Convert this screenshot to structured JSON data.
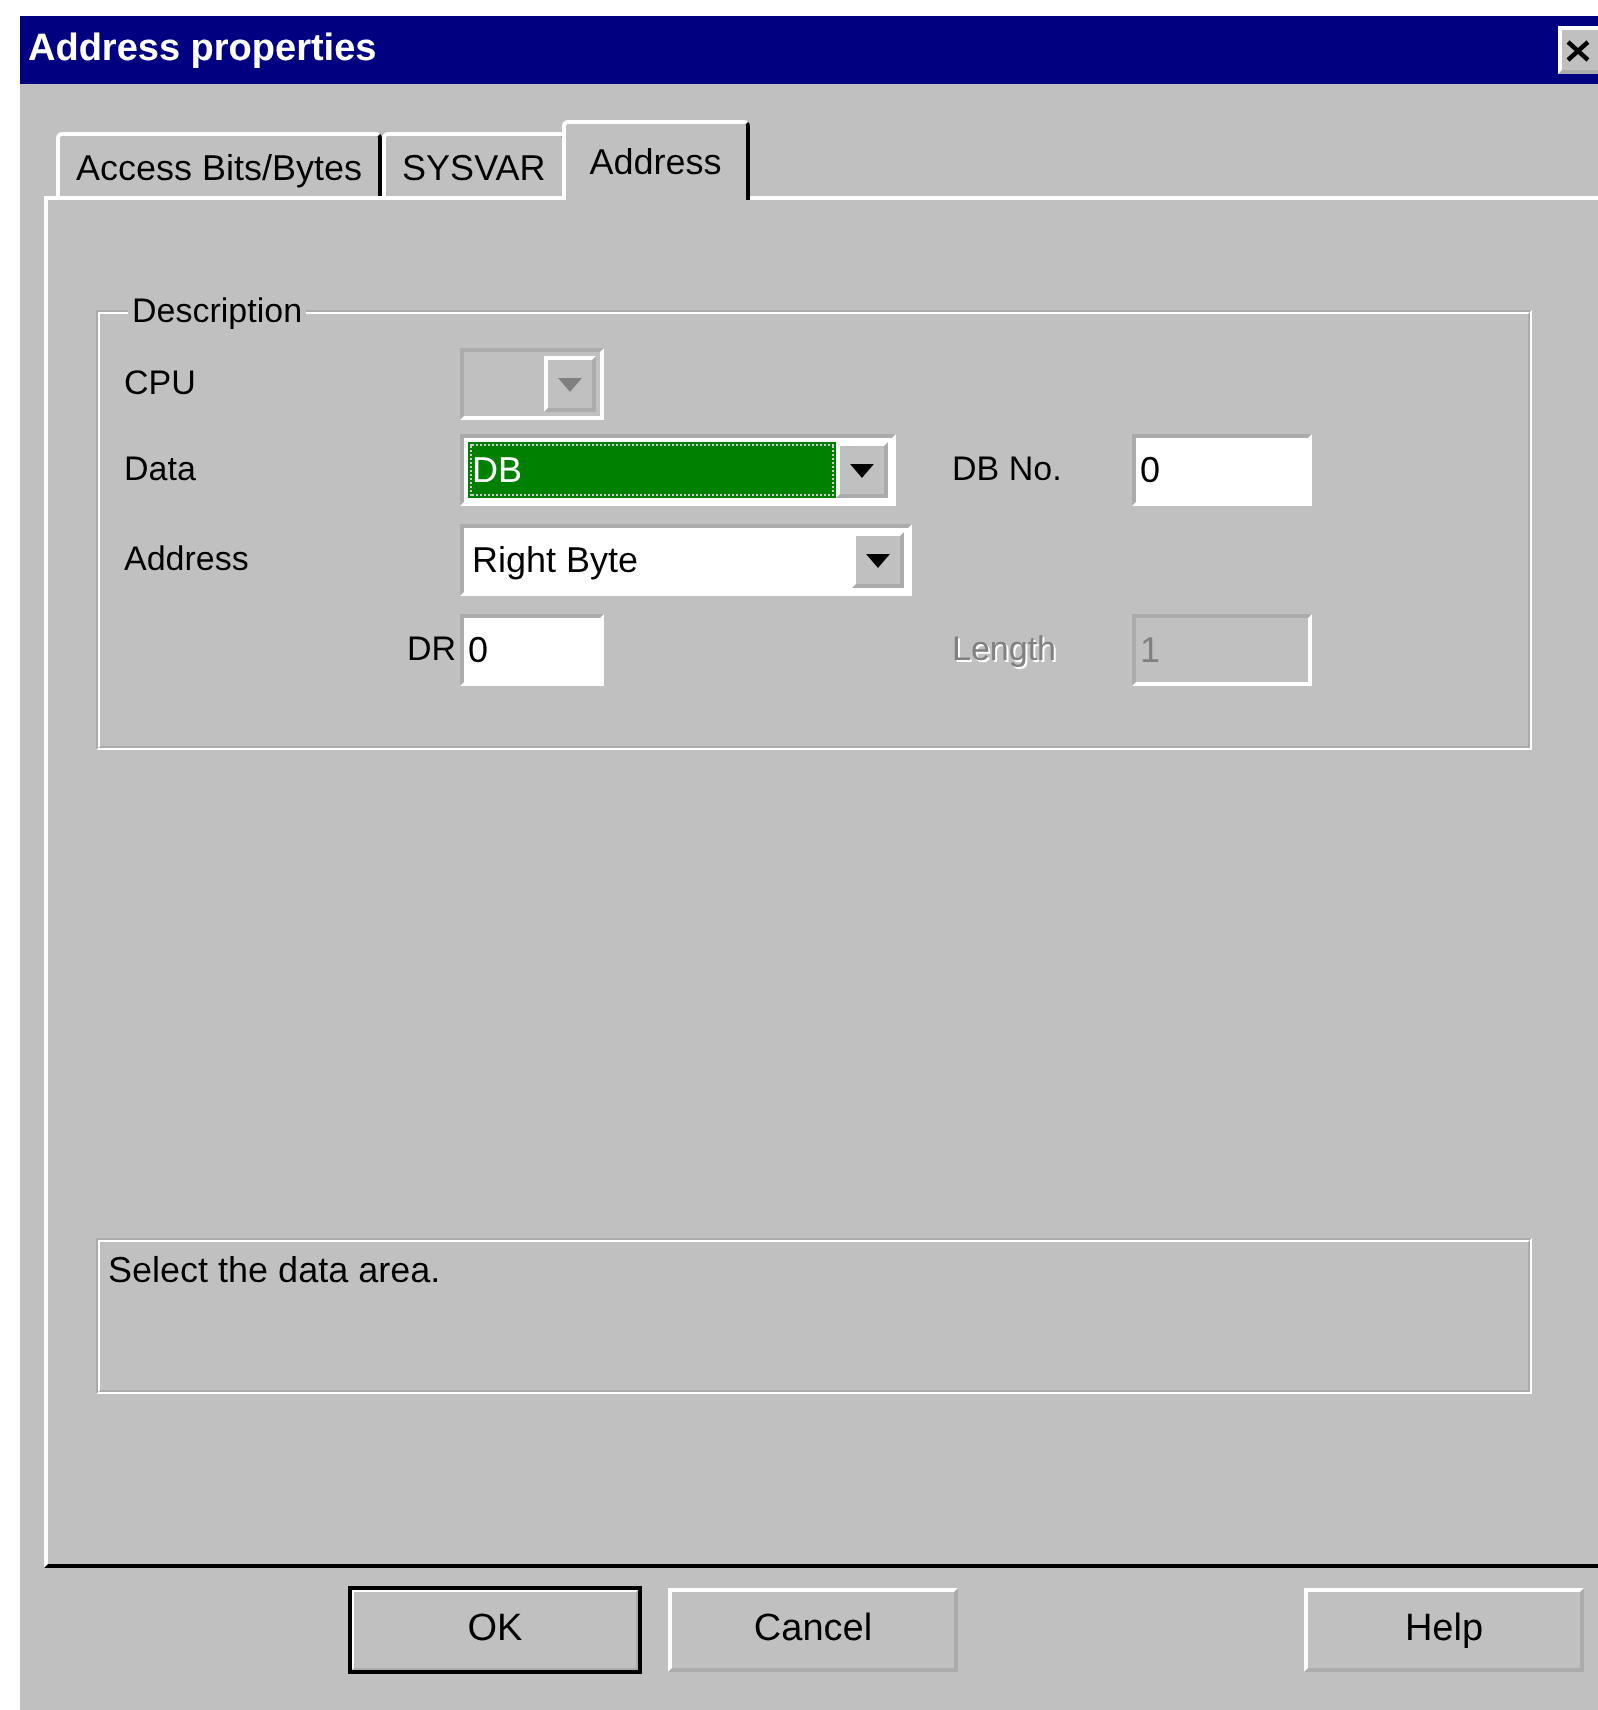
{
  "window": {
    "title": "Address properties"
  },
  "tabs": [
    {
      "label": "Access Bits/Bytes",
      "selected": false
    },
    {
      "label": "SYSVAR",
      "selected": false
    },
    {
      "label": "Address",
      "selected": true
    }
  ],
  "group": {
    "title": "Description",
    "cpu": {
      "label": "CPU",
      "disabled": true
    },
    "data": {
      "label": "Data",
      "value": "DB",
      "focused": true,
      "disabled": false
    },
    "db_no": {
      "label": "DB No.",
      "value": "0",
      "disabled": false
    },
    "address": {
      "label": "Address",
      "value": "Right Byte",
      "focused": false,
      "disabled": false
    },
    "dr": {
      "label": "DR",
      "value": "0",
      "disabled": false
    },
    "length": {
      "label": "Length",
      "value": "1",
      "disabled": true
    }
  },
  "status": "Select the data area.",
  "buttons": [
    {
      "label": "OK",
      "default": true
    },
    {
      "label": "Cancel",
      "default": false
    },
    {
      "label": "Help",
      "default": false
    }
  ]
}
